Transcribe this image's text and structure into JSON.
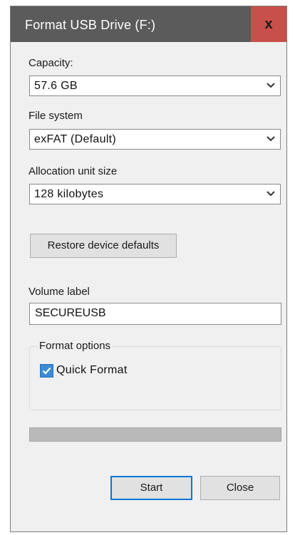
{
  "window": {
    "title": "Format USB Drive (F:)",
    "close_glyph": "x"
  },
  "capacity": {
    "label": "Capacity:",
    "value": "57.6 GB"
  },
  "file_system": {
    "label": "File system",
    "value": "exFAT (Default)"
  },
  "allocation": {
    "label": "Allocation unit size",
    "value": "128 kilobytes"
  },
  "restore_button": "Restore device defaults",
  "volume": {
    "label": "Volume label",
    "value": "SECUREUSB"
  },
  "format_options": {
    "legend": "Format options",
    "quick_format_label": "Quick Format",
    "quick_format_checked": true
  },
  "progress": {
    "fraction": 0
  },
  "buttons": {
    "start": "Start",
    "close": "Close"
  },
  "icons": {
    "dropdown": "chevron-down-icon",
    "close": "close-icon",
    "check": "checkmark-icon"
  },
  "colors": {
    "titlebar": "#5b5b5b",
    "close_button": "#c8504a",
    "checkbox": "#3b8bd6",
    "dialog_bg": "#f0f0f0"
  }
}
